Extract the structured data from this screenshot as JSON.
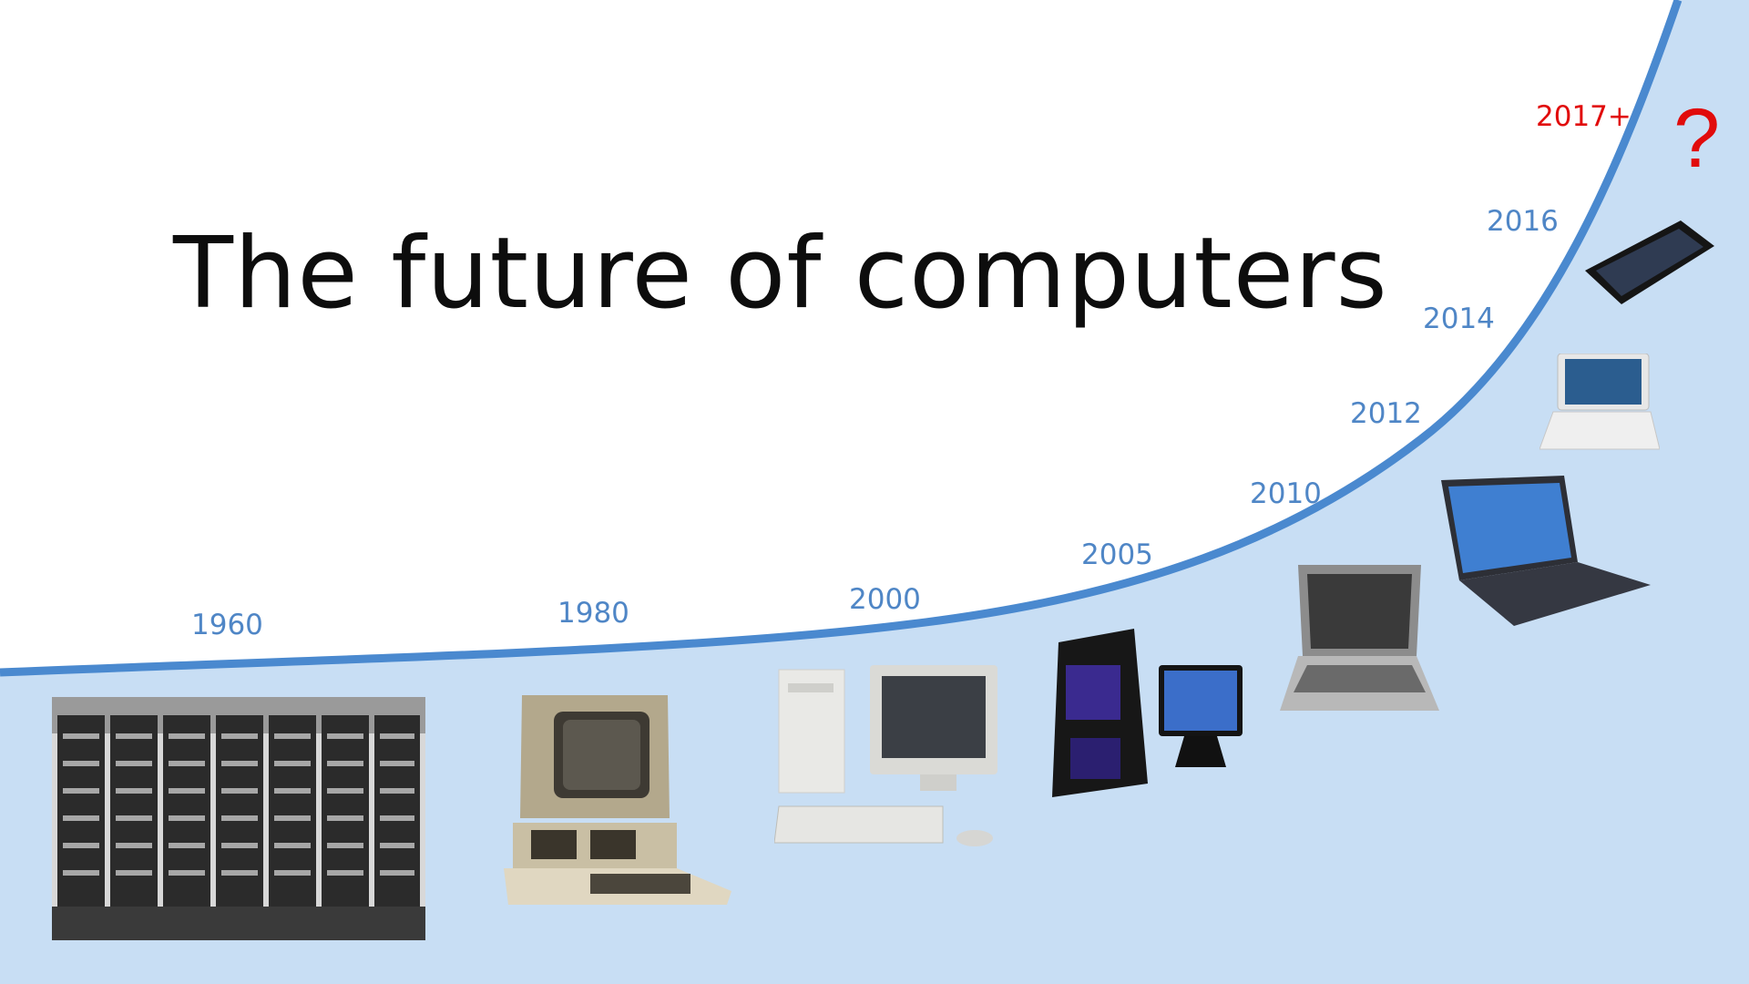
{
  "slide": {
    "title": "The future of computers",
    "question_mark": "?",
    "colors": {
      "curve": "#4a89cf",
      "fill": "#c8def4",
      "year_label": "#4f86c6",
      "future_label": "#e10b0b",
      "title": "#0d0d0d"
    },
    "milestones": [
      {
        "year": "1960",
        "device": "mainframe-computer-photo"
      },
      {
        "year": "1980",
        "device": "personal-computer-photo"
      },
      {
        "year": "2000",
        "device": "desktop-pc-photo"
      },
      {
        "year": "2005",
        "device": "gaming-pc-photo"
      },
      {
        "year": "2010",
        "device": "laptop-photo"
      },
      {
        "year": "2012",
        "device": "ultrabook-photo"
      },
      {
        "year": "2014",
        "device": "netbook-photo"
      },
      {
        "year": "2016",
        "device": "smartphone-photo"
      },
      {
        "year": "2017+",
        "device": "unknown-future-device"
      }
    ]
  }
}
